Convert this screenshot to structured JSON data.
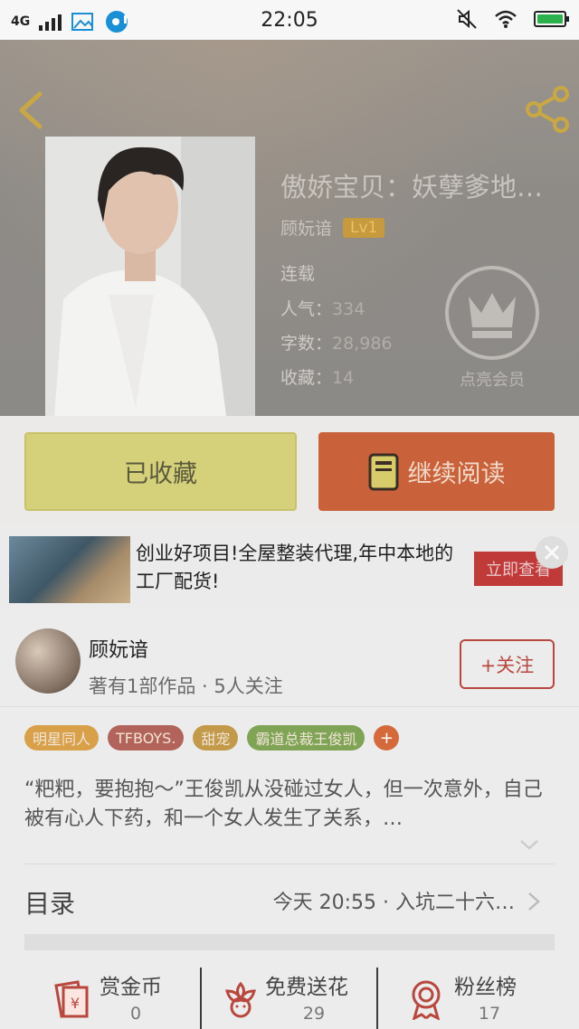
{
  "status_bar": {
    "network": "4G",
    "time": "22:05"
  },
  "book": {
    "title": "傲娇宝贝：妖孽爹地…",
    "author": "顾妧谙",
    "level": "Lv1",
    "status": "连载",
    "popularity_label": "人气：",
    "popularity": "334",
    "word_count_label": "字数：",
    "word_count": "28,986",
    "favorites_label": "收藏：",
    "favorites": "14",
    "vip_label": "点亮会员"
  },
  "actions": {
    "favorited_label": "已收藏",
    "continue_label": "继续阅读"
  },
  "ad": {
    "text": "创业好项目!全屋整装代理,年中本地的工厂配货!",
    "cta": "立即查看"
  },
  "author_card": {
    "name": "顾妧谙",
    "stats": "著有1部作品 · 5人关注",
    "follow_label": "+关注"
  },
  "tags": [
    {
      "label": "明星同人",
      "color": "#d9a04a"
    },
    {
      "label": "TFBOYS.",
      "color": "#b2645a"
    },
    {
      "label": "甜宠",
      "color": "#c39a4a"
    },
    {
      "label": "霸道总裁王俊凯",
      "color": "#7fa456"
    }
  ],
  "tags_more": "+",
  "synopsis": "“粑粑，要抱抱～”王俊凯从没碰过女人，但一次意外，自己被有心人下药，和一个女人发生了关系，…",
  "toc": {
    "label": "目录",
    "latest": "今天 20:55 · 入坑二十六…"
  },
  "bottom_stats": [
    {
      "label": "赏金币",
      "value": "0",
      "icon": "coin-envelope-icon"
    },
    {
      "label": "免费送花",
      "value": "29",
      "icon": "flower-icon"
    },
    {
      "label": "粉丝榜",
      "value": "17",
      "icon": "medal-icon"
    }
  ],
  "colors": {
    "accent_red": "#c9623b",
    "favorite_yellow": "#d5d07a",
    "follow_red": "#b8473e"
  }
}
